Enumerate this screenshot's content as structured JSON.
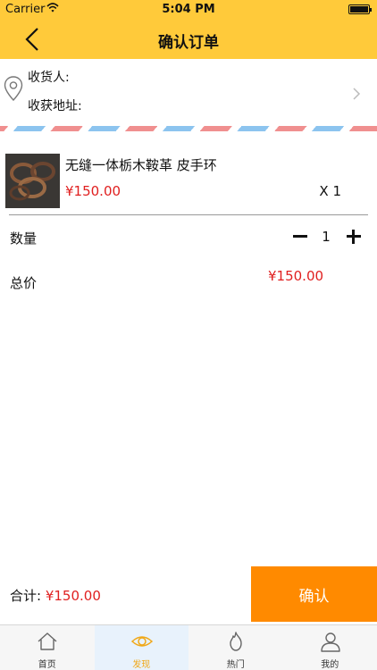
{
  "status_bar": {
    "carrier": "Carrier",
    "time": "5:04 PM"
  },
  "nav": {
    "title": "确认订单"
  },
  "address": {
    "receiver_label": "收货人:",
    "address_label": "收获地址:"
  },
  "product": {
    "name": "无缝一体栃木鞍革 皮手环",
    "price": "¥150.00",
    "quantity": "X 1"
  },
  "order": {
    "quantity_label": "数量",
    "quantity_value": "1",
    "total_label": "总价",
    "total_value": "¥150.00"
  },
  "footer": {
    "sum_label": "合计: ",
    "sum_value": "¥150.00",
    "confirm_label": "确认"
  },
  "tabbar": {
    "tabs": [
      {
        "label": "首页",
        "icon": "home-icon",
        "active": false
      },
      {
        "label": "发现",
        "icon": "eye-icon",
        "active": true
      },
      {
        "label": "热门",
        "icon": "flame-icon",
        "active": false
      },
      {
        "label": "我的",
        "icon": "user-icon",
        "active": false
      }
    ]
  },
  "colors": {
    "theme_yellow": "#ffca3a",
    "confirm_orange": "#ff8a00",
    "price_red": "#e02020",
    "active_tab": "#f0a818"
  }
}
